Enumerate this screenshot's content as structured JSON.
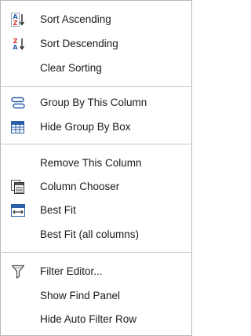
{
  "menu": {
    "items": [
      {
        "label": "Sort Ascending",
        "icon": "sort-ascending-icon"
      },
      {
        "label": "Sort Descending",
        "icon": "sort-descending-icon"
      },
      {
        "label": "Clear Sorting",
        "icon": ""
      },
      {
        "label": "Group By This Column",
        "icon": "group-by-column-icon"
      },
      {
        "label": "Hide Group By Box",
        "icon": "group-by-box-icon"
      },
      {
        "label": "Remove This Column",
        "icon": ""
      },
      {
        "label": "Column Chooser",
        "icon": "column-chooser-icon"
      },
      {
        "label": "Best Fit",
        "icon": "best-fit-icon"
      },
      {
        "label": "Best Fit (all columns)",
        "icon": ""
      },
      {
        "label": "Filter Editor...",
        "icon": "filter-icon"
      },
      {
        "label": "Show Find Panel",
        "icon": ""
      },
      {
        "label": "Hide Auto Filter Row",
        "icon": ""
      }
    ]
  },
  "colors": {
    "icon_blue": "#2b5fa8",
    "icon_red": "#d0312d",
    "text": "#1a1a1a",
    "separator": "#c8c8c8"
  }
}
